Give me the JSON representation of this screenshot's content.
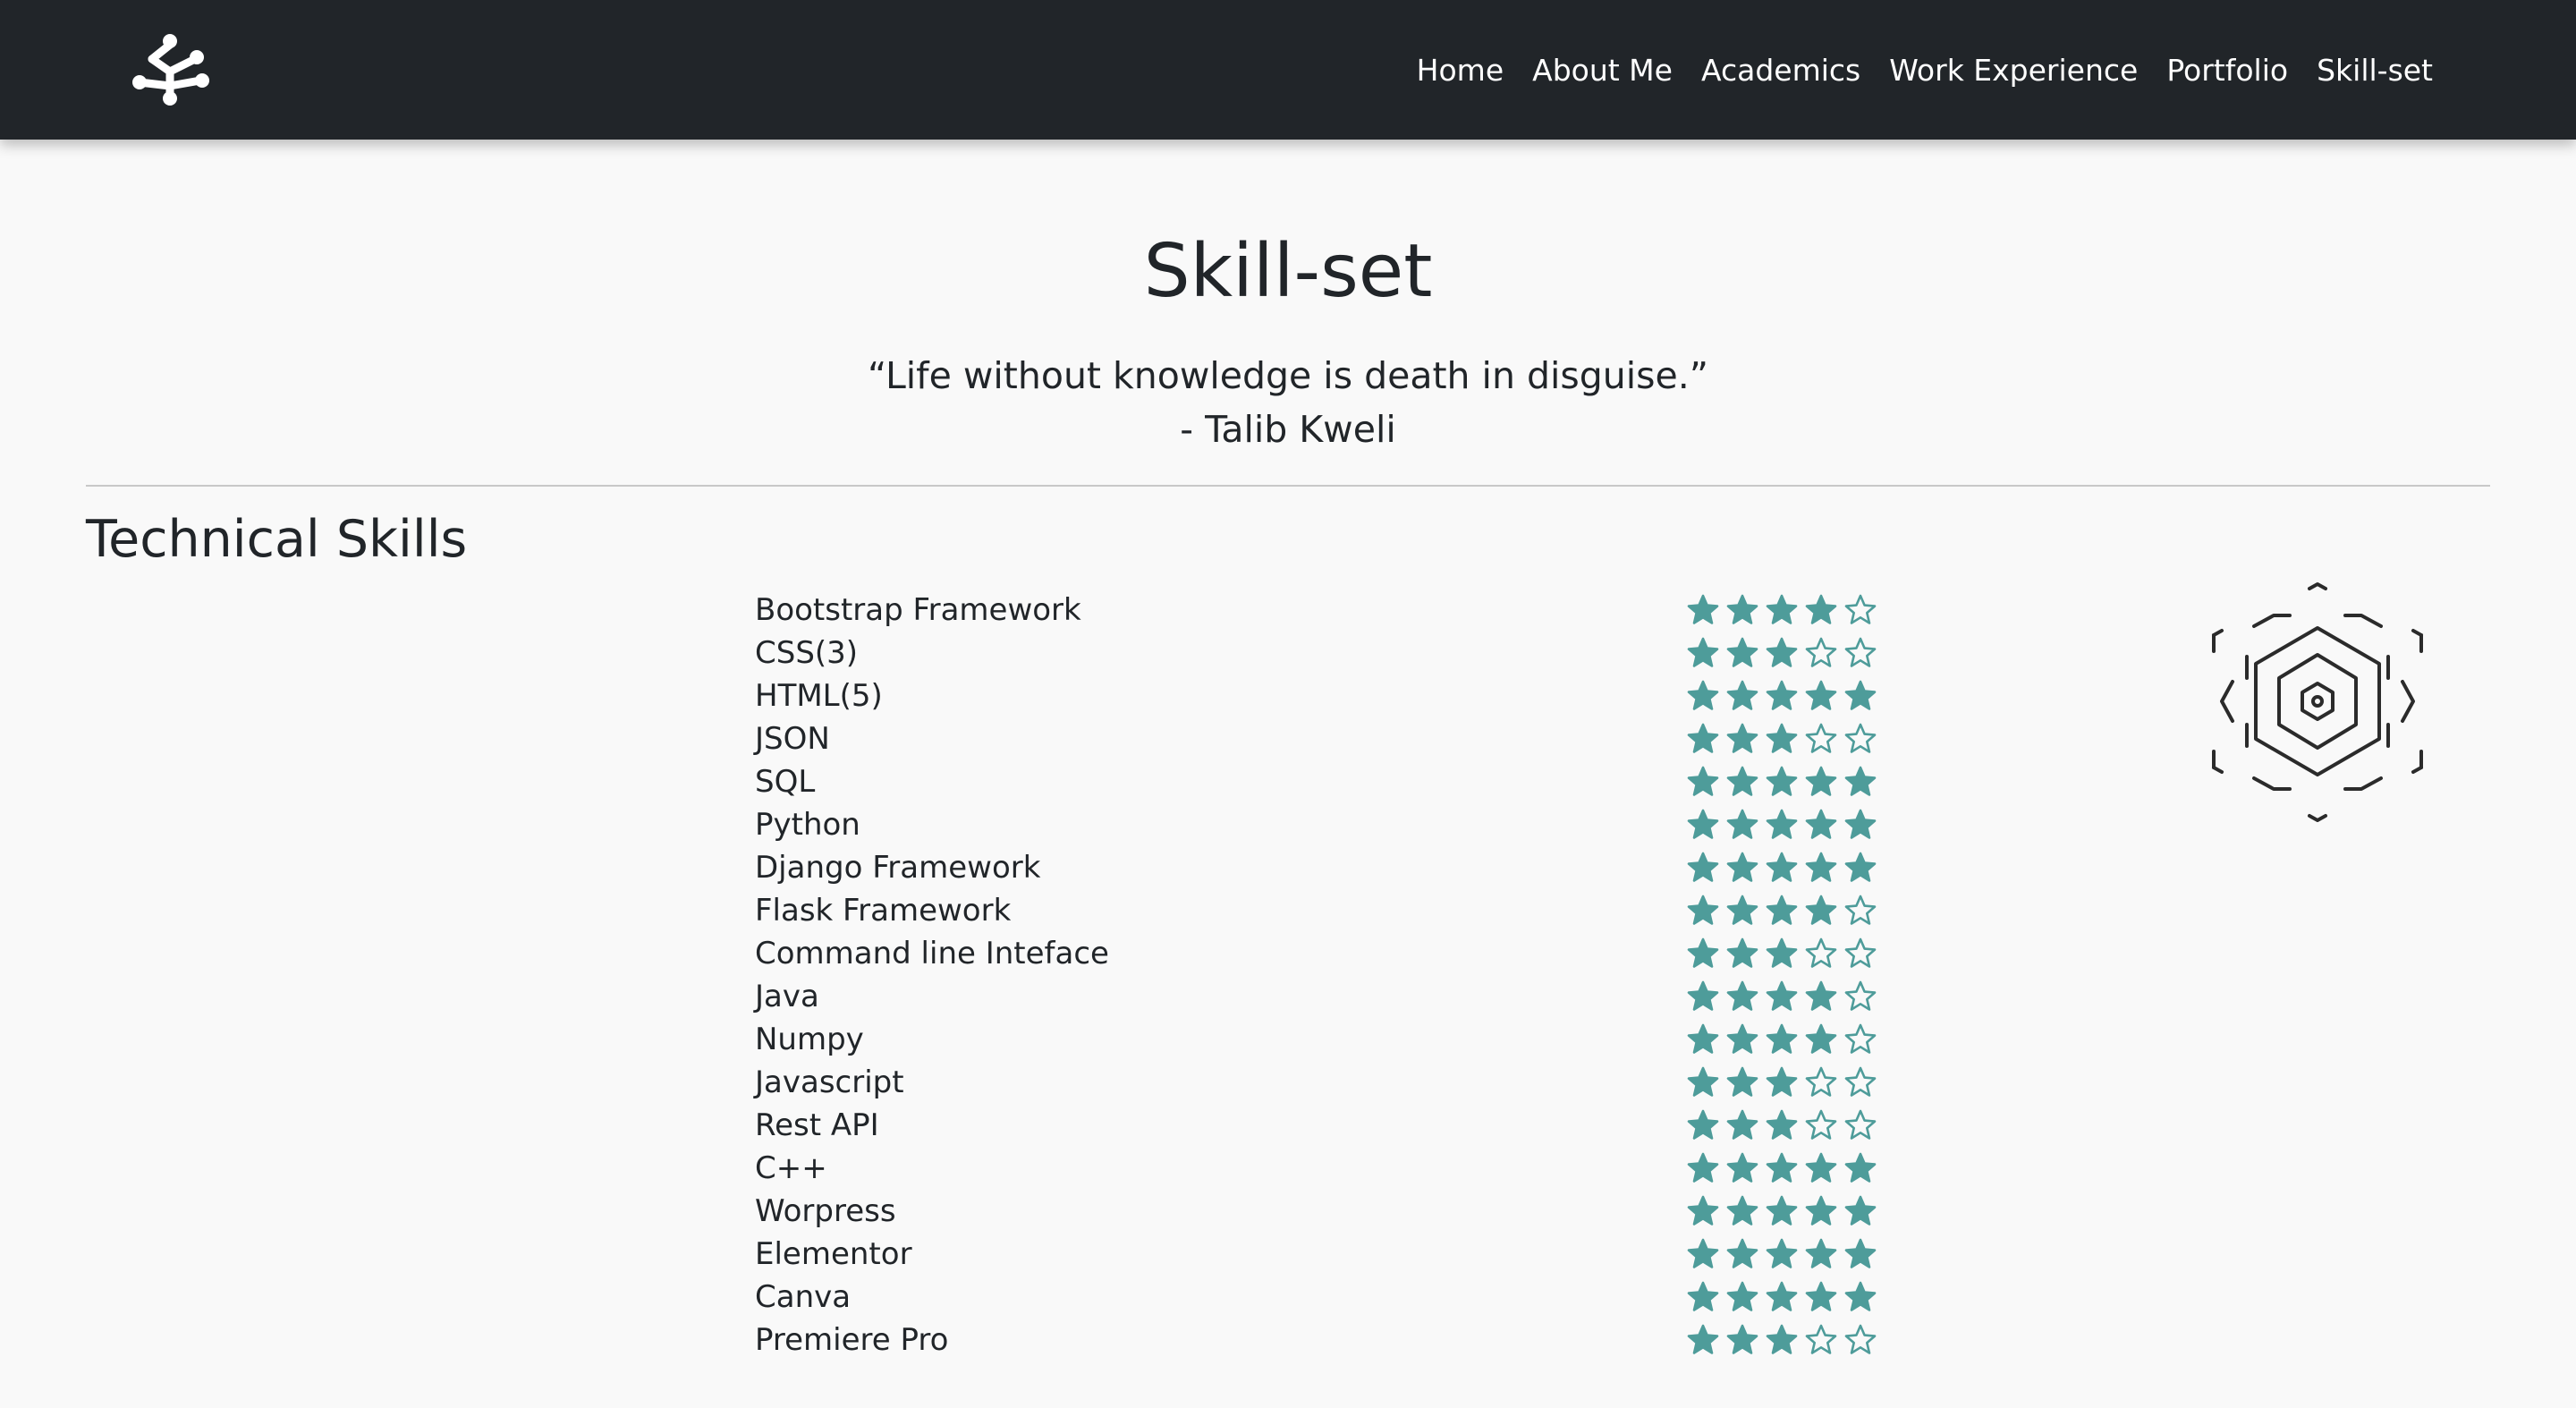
{
  "nav": {
    "logo_icon": "network-graph-icon",
    "links": [
      "Home",
      "About Me",
      "Academics",
      "Work Experience",
      "Portfolio",
      "Skill-set"
    ]
  },
  "page": {
    "title": "Skill-set",
    "quote": "“Life without knowledge is death in disguise.”",
    "quote_author": "- Talib Kweli"
  },
  "technical": {
    "heading": "Technical Skills",
    "max_rating": 5,
    "star_color": "#4e9c9a",
    "skills": [
      {
        "name": "Bootstrap Framework",
        "rating": 4
      },
      {
        "name": "CSS(3)",
        "rating": 3
      },
      {
        "name": "HTML(5)",
        "rating": 5
      },
      {
        "name": "JSON",
        "rating": 3
      },
      {
        "name": "SQL",
        "rating": 5
      },
      {
        "name": "Python",
        "rating": 5
      },
      {
        "name": "Django Framework",
        "rating": 5
      },
      {
        "name": "Flask Framework",
        "rating": 4
      },
      {
        "name": "Command line Inteface",
        "rating": 3
      },
      {
        "name": "Java",
        "rating": 4
      },
      {
        "name": "Numpy",
        "rating": 4
      },
      {
        "name": "Javascript",
        "rating": 3
      },
      {
        "name": "Rest API",
        "rating": 3
      },
      {
        "name": "C++",
        "rating": 5
      },
      {
        "name": "Worpress",
        "rating": 5
      },
      {
        "name": "Elementor",
        "rating": 5
      },
      {
        "name": "Canva",
        "rating": 5
      },
      {
        "name": "Premiere Pro",
        "rating": 3
      }
    ]
  },
  "decor": {
    "badge_icon": "hexagon-emblem-icon"
  }
}
